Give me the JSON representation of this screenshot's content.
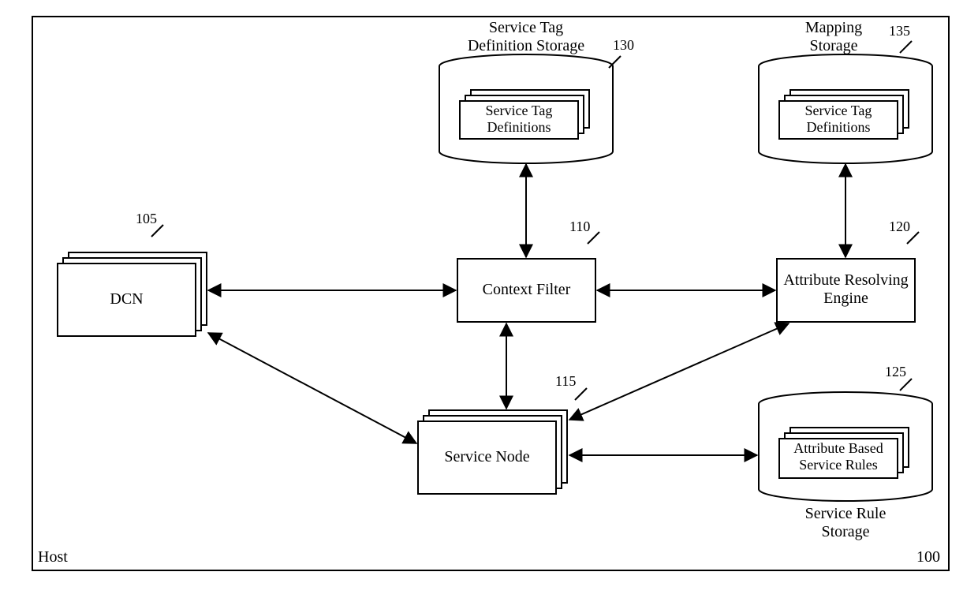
{
  "frame": {
    "host_label": "Host",
    "host_ref": "100"
  },
  "nodes": {
    "dcn": {
      "label": "DCN",
      "ref": "105"
    },
    "cfilter": {
      "label": "Context Filter",
      "ref": "110"
    },
    "svcnode": {
      "label": "Service Node",
      "ref": "115"
    },
    "are": {
      "label": "Attribute Resolving\nEngine",
      "ref": "120"
    },
    "svcrules": {
      "label": "Attribute Based\nService Rules",
      "ref": "125",
      "storage_label": "Service Rule\nStorage"
    },
    "tagdef": {
      "label": "Service Tag\nDefinitions",
      "ref": "130",
      "storage_label": "Service Tag\nDefinition Storage"
    },
    "mapstore": {
      "label": "Service Tag\nDefinitions",
      "ref": "135",
      "storage_label": "Mapping\nStorage"
    }
  }
}
